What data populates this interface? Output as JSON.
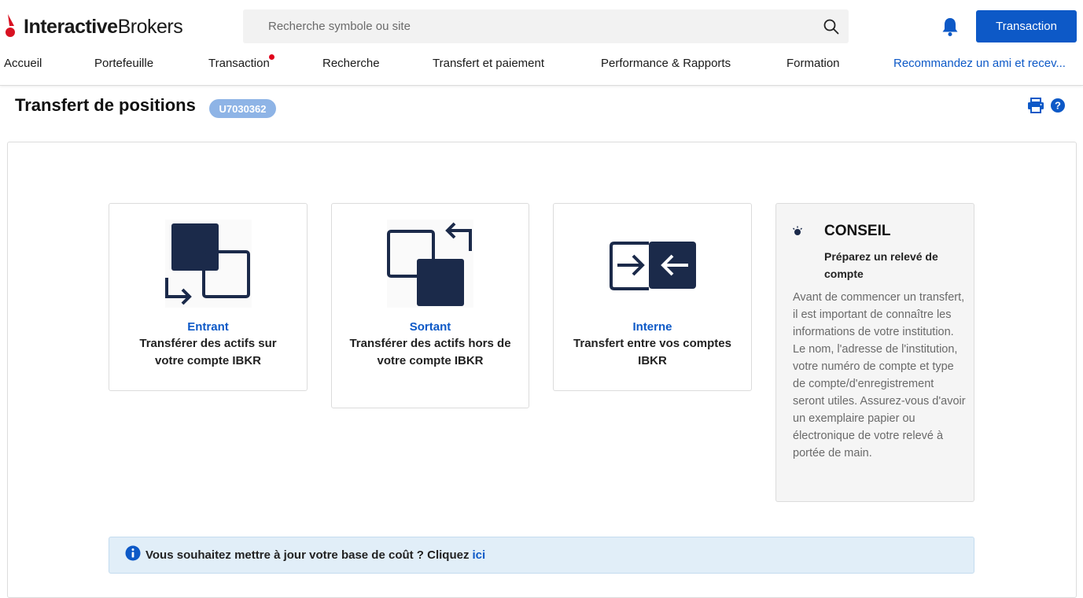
{
  "header": {
    "logo_text_bold": "Interactive",
    "logo_text_regular": "Brokers",
    "search_placeholder": "Recherche symbole ou site",
    "trade_button": "Transaction"
  },
  "nav": {
    "items": [
      {
        "label": "Accueil"
      },
      {
        "label": "Portefeuille"
      },
      {
        "label": "Transaction"
      },
      {
        "label": "Recherche"
      },
      {
        "label": "Transfert et paiement"
      },
      {
        "label": "Performance & Rapports"
      },
      {
        "label": "Formation"
      },
      {
        "label": "Recommandez un ami et recev..."
      }
    ]
  },
  "page": {
    "title": "Transfert de positions",
    "account_id": "U7030362"
  },
  "cards": [
    {
      "title": "Entrant",
      "description": "Transférer des actifs sur votre compte IBKR"
    },
    {
      "title": "Sortant",
      "description": "Transférer des actifs hors de votre compte IBKR"
    },
    {
      "title": "Interne",
      "description": "Transfert entre vos comptes IBKR"
    }
  ],
  "tip": {
    "heading": "CONSEIL",
    "subheading": "Préparez un relevé de compte",
    "body": "Avant de commencer un transfert, il est important de connaître les informations de votre institution. Le nom, l'adresse de l'institution, votre numéro de compte et type de compte/d'enregistrement seront utiles. Assurez-vous d'avoir un exemplaire papier ou électronique de votre relevé à portée de main."
  },
  "info_bar": {
    "text": "Vous souhaitez mettre à jour votre base de coût ? Cliquez",
    "link": "ici"
  },
  "colors": {
    "brand_blue": "#0d59c7",
    "brand_red": "#d81222",
    "navy_icon": "#1b2a4a",
    "badge_bg": "#8eb4e6",
    "info_bg": "#e1eef8"
  }
}
